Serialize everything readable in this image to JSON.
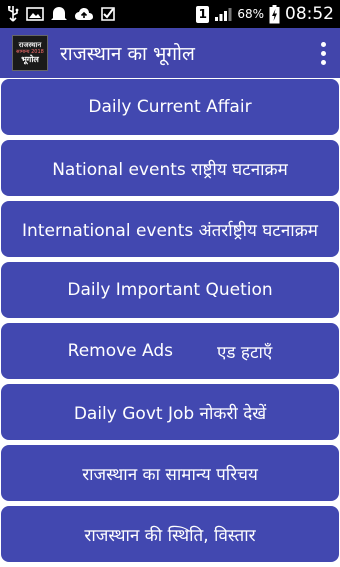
{
  "status_bar": {
    "icons": [
      "usb-icon",
      "image-icon",
      "notification-icon",
      "cloud-upload-icon",
      "download-check-icon"
    ],
    "sim_slot": "1",
    "battery_percent": "68%",
    "time": "08:52"
  },
  "app_bar": {
    "logo_line1": "राजस्थान",
    "logo_line2": "सामान्य 2018",
    "logo_line3": "भूगोल",
    "title": "राजस्थान का भूगोल",
    "menu_icon": "more-vert-icon"
  },
  "menu": {
    "items": [
      {
        "label": "Daily Current Affair"
      },
      {
        "label": "National events राष्ट्रीय घटनाक्रम"
      },
      {
        "label": "International events अंतर्राष्ट्रीय घटनाक्रम"
      },
      {
        "label": "Daily Important Quetion"
      },
      {
        "label_a": "Remove Ads",
        "label_b": "एड हटाएँ"
      },
      {
        "label": "Daily Govt Job नोकरी देखें"
      },
      {
        "label": "राजस्थान का सामान्य परिचय"
      },
      {
        "label": "राजस्थान की स्थिति, विस्तार"
      }
    ]
  },
  "colors": {
    "app_bar": "#4245ab",
    "button": "#4248b0",
    "status_bar": "#000000"
  }
}
